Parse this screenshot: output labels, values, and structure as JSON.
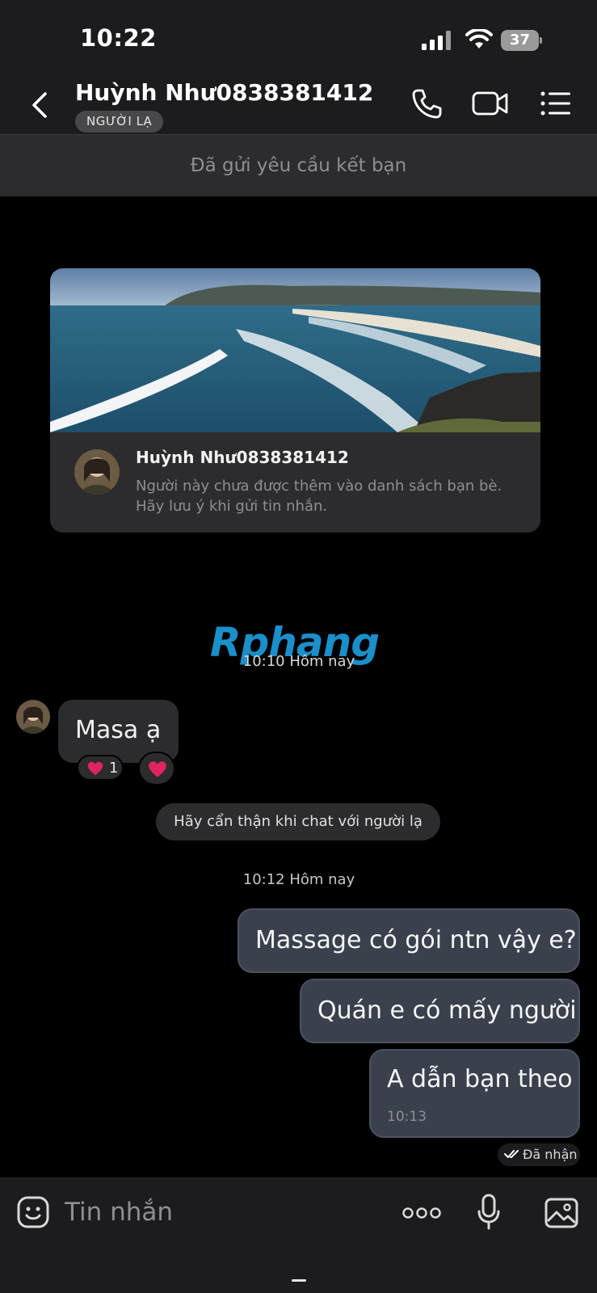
{
  "status_bar": {
    "time": "10:22",
    "battery": "37"
  },
  "header": {
    "contact_name": "Huỳnh Như0838381412",
    "badge": "NGƯỜI LẠ"
  },
  "friend_request_bar": "Đã gửi yêu cầu kết bạn",
  "profile_card": {
    "name": "Huỳnh Như0838381412",
    "note": "Người này chưa được thêm vào danh sách bạn bè. Hãy lưu ý khi gửi tin nhắn."
  },
  "watermark": "Rphang",
  "messages": {
    "timestamp_1": "10:10 Hôm nay",
    "incoming": {
      "text": "Masa ạ",
      "reaction_count": "1"
    },
    "warning": "Hãy cẩn thận khi chat với người lạ",
    "timestamp_2": "10:12 Hôm nay",
    "outgoing": [
      {
        "text": "Massage có gói ntn vậy e?"
      },
      {
        "text": "Quán e có mấy người"
      },
      {
        "text": "A dẫn bạn theo",
        "time": "10:13"
      }
    ],
    "delivered": "Đã nhận"
  },
  "composer": {
    "placeholder": "Tin nhắn"
  },
  "icons": {
    "back": "chevron-left-icon",
    "call": "phone-icon",
    "video": "video-camera-icon",
    "menu": "list-menu-icon",
    "emoji": "emoji-sticker-icon",
    "more": "more-dots-icon",
    "mic": "microphone-icon",
    "image": "image-gallery-icon",
    "reaction": "heart-icon"
  },
  "colors": {
    "background": "#000000",
    "header": "#1c1c1e",
    "incoming_bubble": "#2c2c2e",
    "outgoing_bubble": "#3a404c",
    "heart": "#e0245e"
  }
}
